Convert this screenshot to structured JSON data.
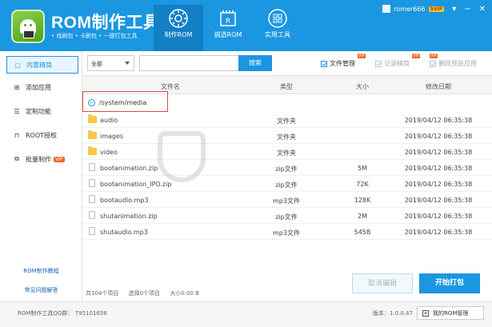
{
  "header": {
    "title": "ROM制作工具",
    "subtitle": "• 戏刷包 • 卡刷包 • 一键打包工具",
    "tools": [
      {
        "label": "制作ROM",
        "icon": "gear-icon"
      },
      {
        "label": "挑选ROM",
        "icon": "rom-chip-icon"
      },
      {
        "label": "实用工具",
        "icon": "grid-icon"
      }
    ],
    "username": "romer666",
    "badge": "SVIP"
  },
  "sidebar": {
    "items": [
      {
        "label": "内置精简",
        "icon": "app-icon"
      },
      {
        "label": "添加应用",
        "icon": "plus-box-icon"
      },
      {
        "label": "定制功能",
        "icon": "document-icon"
      },
      {
        "label": "ROOT授权",
        "icon": "lock-icon"
      },
      {
        "label": "批量制作",
        "icon": "batch-icon",
        "tag": "VIP"
      }
    ],
    "links": [
      "ROM制作教程",
      "常见问题解答"
    ]
  },
  "toolbar": {
    "filter_value": "全部",
    "search_placeholder": "",
    "search_label": "搜索",
    "checkboxes": [
      {
        "label": "文件管理",
        "checked": true,
        "enabled": true,
        "tag": "VIP"
      },
      {
        "label": "记录精简",
        "checked": true,
        "enabled": false,
        "tag": "VIP"
      },
      {
        "label": "删除预装应用",
        "checked": true,
        "enabled": false,
        "tag": "VIP"
      }
    ]
  },
  "table": {
    "columns": [
      "文件名",
      "类型",
      "大小",
      "修改日期"
    ],
    "path": "/system/media",
    "rows": [
      {
        "name": "audio",
        "type": "文件夹",
        "size": "",
        "date": "2019/04/12 06:35:38",
        "kind": "folder"
      },
      {
        "name": "images",
        "type": "文件夹",
        "size": "",
        "date": "2019/04/12 06:35:38",
        "kind": "folder"
      },
      {
        "name": "video",
        "type": "文件夹",
        "size": "",
        "date": "2019/04/12 06:35:38",
        "kind": "folder"
      },
      {
        "name": "bootanimation.zip",
        "type": "zip文件",
        "size": "5M",
        "date": "2019/04/12 06:35:38",
        "kind": "file"
      },
      {
        "name": "bootanimation_IPO.zip",
        "type": "zip文件",
        "size": "72K",
        "date": "2019/04/12 06:35:38",
        "kind": "file"
      },
      {
        "name": "bootaudio.mp3",
        "type": "mp3文件",
        "size": "128K",
        "date": "2019/04/12 06:35:38",
        "kind": "file"
      },
      {
        "name": "shutanimation.zip",
        "type": "zip文件",
        "size": "2M",
        "date": "2019/04/12 06:35:38",
        "kind": "file"
      },
      {
        "name": "shutaudio.mp3",
        "type": "mp3文件",
        "size": "545B",
        "date": "2019/04/12 06:35:38",
        "kind": "file"
      }
    ]
  },
  "footer": {
    "total": "共104个项目",
    "selected": "选择0个项目",
    "size": "大小0.00 B",
    "cancel_label": "取消编辑",
    "start_label": "开始打包"
  },
  "statusbar": {
    "qq_label": "ROM制作工具QQ群：",
    "qq_value": "795101656",
    "version": "版本：1.0.0.47",
    "my_rom_label": "我的ROM管理"
  },
  "colors": {
    "accent": "#1b96e1",
    "vip": "#f26522",
    "folder": "#f8c74a"
  }
}
